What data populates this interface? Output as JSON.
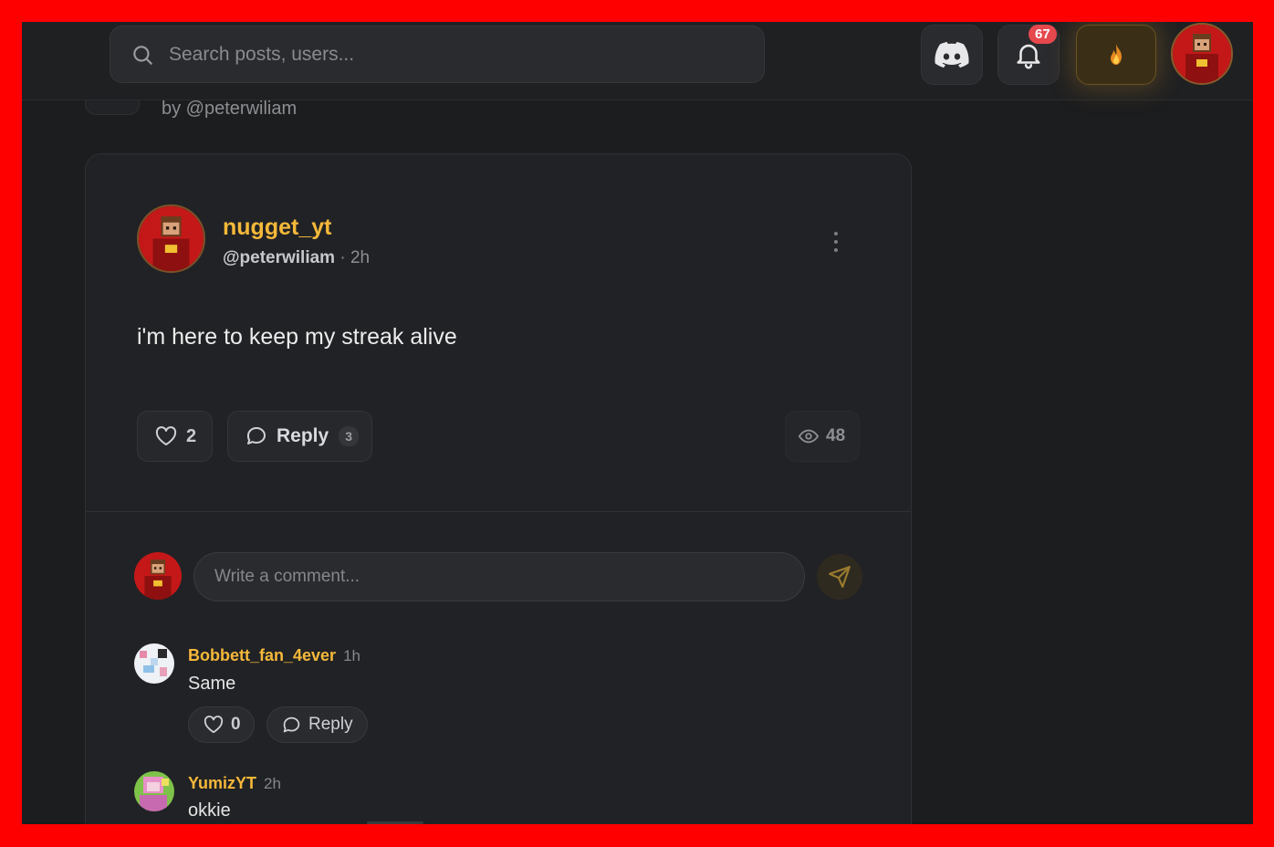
{
  "header": {
    "search_placeholder": "Search posts, users...",
    "notification_count": "67"
  },
  "previous_post": {
    "byline": "by @peterwiliam"
  },
  "post": {
    "display_name": "nugget_yt",
    "handle": "@peterwiliam",
    "time": "· 2h",
    "text": "i'm here to keep my streak alive",
    "likes": "2",
    "reply_label": "Reply",
    "reply_count": "3",
    "views": "48"
  },
  "composer": {
    "placeholder": "Write a comment..."
  },
  "comments": [
    {
      "name": "Bobbett_fan_4ever",
      "time": "1h",
      "text": "Same",
      "likes": "0",
      "reply_label": "Reply"
    },
    {
      "name": "YumizYT",
      "time": "2h",
      "text": "okkie"
    }
  ],
  "colors": {
    "accent": "#f5b83a",
    "badge": "#e5484d",
    "background": "#1c1d1f",
    "card": "#212225"
  },
  "icons": [
    "search-icon",
    "discord-icon",
    "bell-icon",
    "flame-icon",
    "heart-icon",
    "comment-icon",
    "eye-icon",
    "send-icon",
    "kebab-icon"
  ]
}
